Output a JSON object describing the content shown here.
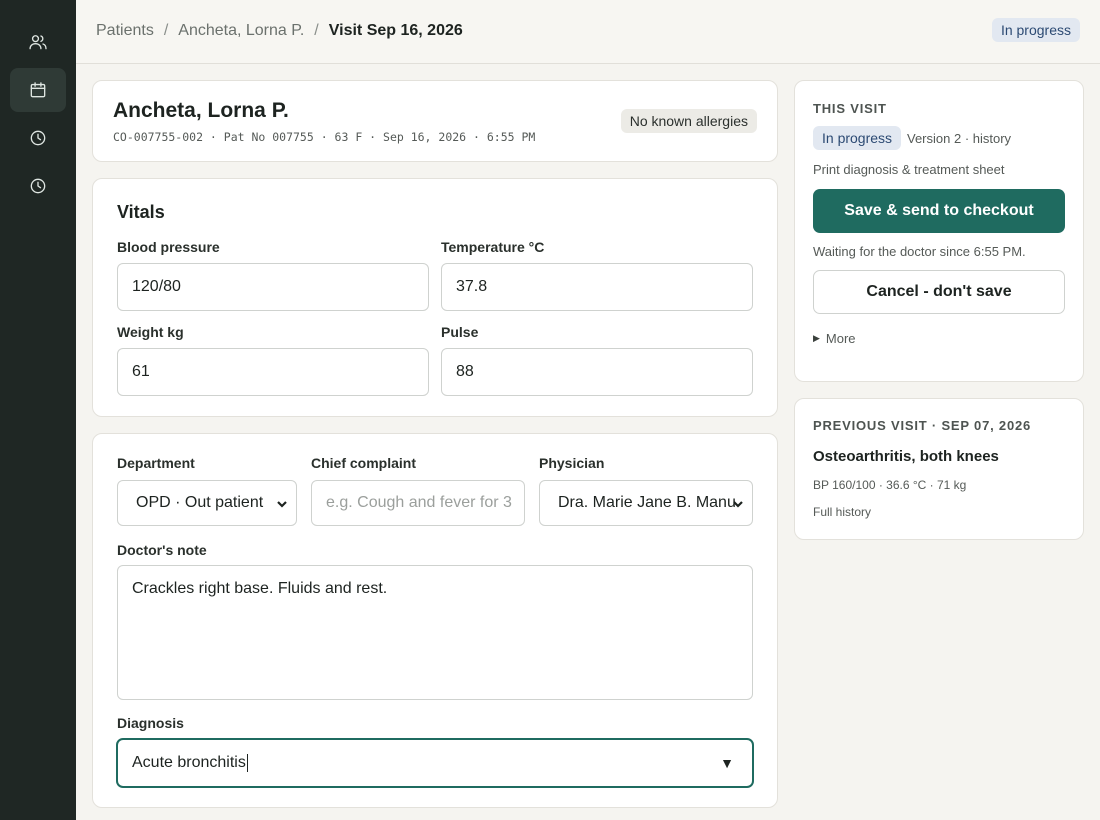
{
  "nav": {
    "items": [
      {
        "icon": "users-icon",
        "active": false
      },
      {
        "icon": "calendar-icon",
        "active": true
      },
      {
        "icon": "clock-icon",
        "active": false
      },
      {
        "icon": "clock-icon",
        "active": false
      }
    ]
  },
  "breadcrumb": {
    "root": "Patients",
    "patient": "Ancheta, Lorna P.",
    "current": "Visit Sep 16, 2026",
    "separator": "/"
  },
  "status_badge": "In progress",
  "patient": {
    "name": "Ancheta, Lorna P.",
    "meta": "CO-007755-002 · Pat No 007755 · 63 F · Sep 16, 2026 · 6:55 PM",
    "allergy": "No known allergies"
  },
  "vitals": {
    "title": "Vitals",
    "bp_label": "Blood pressure",
    "bp_value": "120/80",
    "temp_label": "Temperature °C",
    "temp_value": "37.8",
    "weight_label": "Weight kg",
    "weight_value": "61",
    "pulse_label": "Pulse",
    "pulse_value": "88"
  },
  "consult": {
    "department_label": "Department",
    "department_value": "OPD · Out patient",
    "complaint_label": "Chief complaint",
    "complaint_placeholder": "e.g. Cough and fever for 3",
    "physician_label": "Physician",
    "physician_value": "Dra. Marie Jane B. Manu",
    "note_label": "Doctor's note",
    "note_value": "Crackles right base. Fluids and rest.",
    "diagnosis_label": "Diagnosis",
    "diagnosis_value": "Acute bronchitis"
  },
  "this_visit": {
    "caption": "THIS VISIT",
    "status": "In progress",
    "version": "Version 2 · history",
    "print_link": "Print diagnosis & treatment sheet",
    "save_button": "Save & send to checkout",
    "waiting": "Waiting for the doctor since 6:55 PM.",
    "cancel_button": "Cancel - don't save",
    "more": "More"
  },
  "previous_visit": {
    "caption": "PREVIOUS VISIT · SEP 07, 2026",
    "diagnosis": "Osteoarthritis, both knees",
    "vitals": "BP 160/100 · 36.6 °C · 71 kg",
    "history_link": "Full history"
  },
  "colors": {
    "rail": "#1f2724",
    "accent": "#1f6b60",
    "badge_bg": "#e2e8f1"
  }
}
